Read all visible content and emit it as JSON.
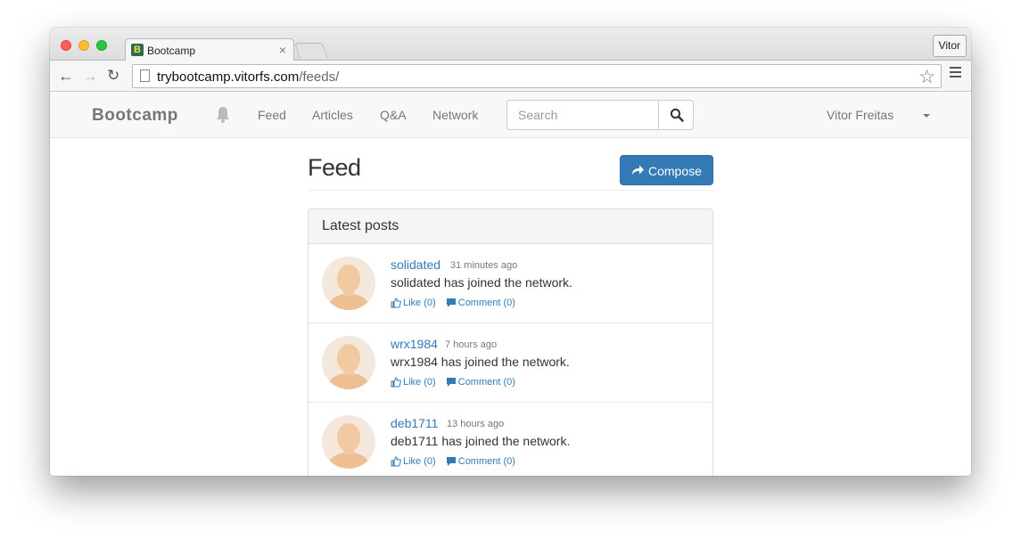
{
  "browser": {
    "tab_title": "Bootcamp",
    "tab_favicon": "B",
    "tab_close": "×",
    "profile": "Vitor",
    "url_host": "trybootcamp.vitorfs.com",
    "url_path": "/feeds/",
    "icons": {
      "back": "arrow-left-icon",
      "forward": "arrow-right-icon",
      "reload": "reload-icon",
      "bookmark": "star-icon",
      "menu": "hamburger-menu-icon"
    }
  },
  "navbar": {
    "brand": "Bootcamp",
    "links": [
      "Feed",
      "Articles",
      "Q&A",
      "Network"
    ],
    "search_placeholder": "Search",
    "user": "Vitor Freitas"
  },
  "main": {
    "title": "Feed",
    "compose_label": "Compose",
    "panel_title": "Latest posts",
    "posts": [
      {
        "author": "solidated",
        "time": "31 minutes ago",
        "text": "solidated has joined the network.",
        "like_label": "Like (0)",
        "comment_label": "Comment (0)"
      },
      {
        "author": "wrx1984",
        "time": "7 hours ago",
        "text": "wrx1984 has joined the network.",
        "like_label": "Like (0)",
        "comment_label": "Comment (0)"
      },
      {
        "author": "deb1711",
        "time": "13 hours ago",
        "text": "deb1711 has joined the network.",
        "like_label": "Like (0)",
        "comment_label": "Comment (0)"
      }
    ]
  },
  "colors": {
    "primary": "#337ab7",
    "navbar_bg": "#f8f8f8",
    "muted_text": "#777777"
  }
}
